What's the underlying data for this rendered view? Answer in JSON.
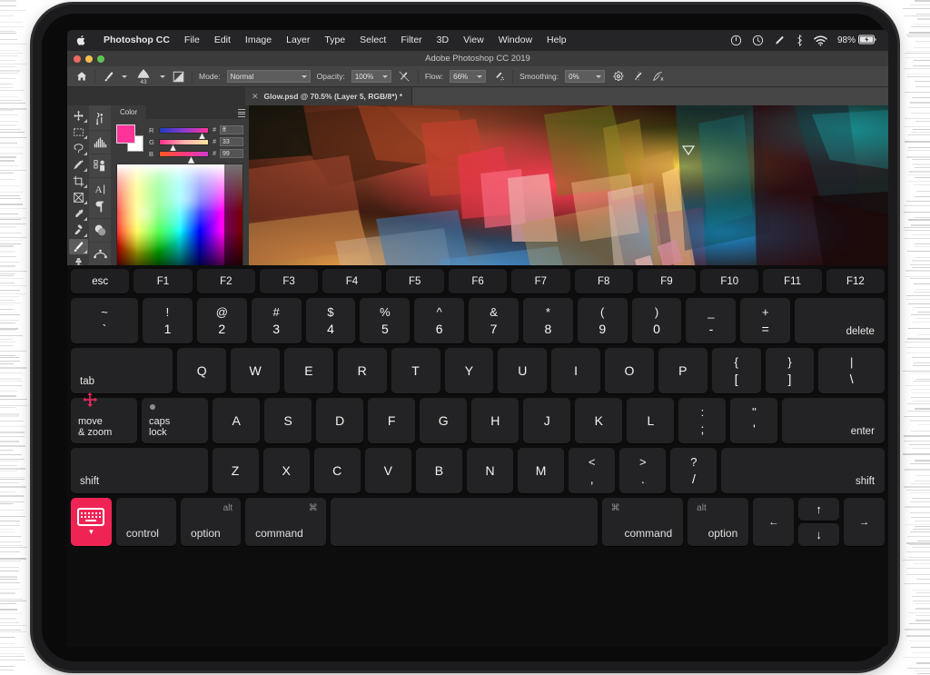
{
  "menubar": {
    "apple_icon": "apple-logo-icon",
    "app_name": "Photoshop CC",
    "items": [
      "File",
      "Edit",
      "Image",
      "Layer",
      "Type",
      "Select",
      "Filter",
      "3D",
      "View",
      "Window",
      "Help"
    ],
    "status": {
      "icons": [
        "power-circle-icon",
        "time-machine-icon",
        "pen-icon",
        "bluetooth-icon",
        "wifi-icon"
      ],
      "battery_percent": "98%",
      "battery_icon": "battery-charging-icon"
    }
  },
  "photoshop": {
    "window_title": "Adobe Photoshop CC 2019",
    "traffic_lights": [
      "close",
      "minimize",
      "zoom"
    ],
    "options_bar": {
      "home_icon": "home-icon",
      "brush_tool_icon": "brush-icon",
      "brush_size": "43",
      "brush_panel_icon": "brush-settings-icon",
      "mode_label": "Mode:",
      "mode_value": "Normal",
      "opacity_label": "Opacity:",
      "opacity_value": "100%",
      "opacity_pressure_icon": "pressure-opacity-icon",
      "flow_label": "Flow:",
      "flow_value": "66%",
      "airbrush_icon": "airbrush-icon",
      "smoothing_label": "Smoothing:",
      "smoothing_value": "0%",
      "smoothing_options_icon": "gear-icon",
      "symmetry_icon": "symmetry-icon",
      "pressure_size_icon": "pressure-size-icon"
    },
    "document_tab": {
      "close_icon": "close-icon",
      "title": "Glow.psd @ 70.5% (Layer 5, RGB/8*) *"
    },
    "toolbox": [
      {
        "name": "move-tool",
        "icon": "move-icon",
        "active": false
      },
      {
        "name": "marquee-tool",
        "icon": "rectangular-marquee-icon",
        "active": false
      },
      {
        "name": "lasso-tool",
        "icon": "lasso-icon",
        "active": false
      },
      {
        "name": "quick-selection-tool",
        "icon": "magic-wand-icon",
        "active": false
      },
      {
        "name": "crop-tool",
        "icon": "crop-icon",
        "active": false
      },
      {
        "name": "frame-tool",
        "icon": "frame-icon",
        "active": false
      },
      {
        "name": "eyedropper-tool",
        "icon": "eyedropper-icon",
        "active": false
      },
      {
        "name": "healing-brush-tool",
        "icon": "healing-brush-icon",
        "active": false
      },
      {
        "name": "brush-tool",
        "icon": "brush-icon",
        "active": true
      },
      {
        "name": "clone-stamp-tool",
        "icon": "clone-stamp-icon",
        "active": false
      },
      {
        "name": "history-brush-tool",
        "icon": "history-brush-icon",
        "active": false
      },
      {
        "name": "eraser-tool",
        "icon": "eraser-icon",
        "active": false
      },
      {
        "name": "gradient-tool",
        "icon": "paint-bucket-icon",
        "active": false
      }
    ],
    "panel_rail": [
      {
        "name": "panel-curves",
        "icon": "curves-icon"
      },
      {
        "name": "panel-histogram",
        "icon": "histogram-icon"
      },
      {
        "name": "panel-adjustments",
        "icon": "adjustments-icon"
      },
      {
        "name": "panel-character",
        "icon": "character-icon"
      },
      {
        "name": "panel-paragraph",
        "icon": "paragraph-icon"
      },
      {
        "name": "panel-layer-comps",
        "icon": "layer-comps-icon"
      },
      {
        "name": "panel-paths",
        "icon": "paths-icon"
      },
      {
        "name": "panel-properties",
        "icon": "properties-icon"
      }
    ],
    "color_panel": {
      "tab_label": "Color",
      "menu_icon": "panel-menu-icon",
      "foreground_color": "#ff3399",
      "background_color": "#ffffff",
      "channels": [
        {
          "label": "R",
          "hash": "#",
          "value": "ff",
          "pos": 100
        },
        {
          "label": "G",
          "hash": "#",
          "value": "33",
          "pos": 20
        },
        {
          "label": "B",
          "hash": "#",
          "value": "99",
          "pos": 60
        }
      ]
    }
  },
  "keyboard": {
    "rows": {
      "function": [
        "esc",
        "F1",
        "F2",
        "F3",
        "F4",
        "F5",
        "F6",
        "F7",
        "F8",
        "F9",
        "F10",
        "F11",
        "F12"
      ],
      "number": [
        {
          "top": "~",
          "bot": "`"
        },
        {
          "top": "!",
          "bot": "1"
        },
        {
          "top": "@",
          "bot": "2"
        },
        {
          "top": "#",
          "bot": "3"
        },
        {
          "top": "$",
          "bot": "4"
        },
        {
          "top": "%",
          "bot": "5"
        },
        {
          "top": "^",
          "bot": "6"
        },
        {
          "top": "&",
          "bot": "7"
        },
        {
          "top": "*",
          "bot": "8"
        },
        {
          "top": "(",
          "bot": "9"
        },
        {
          "top": ")",
          "bot": "0"
        },
        {
          "top": "_",
          "bot": "-"
        },
        {
          "top": "+",
          "bot": "="
        }
      ],
      "delete_label": "delete",
      "tab_label": "tab",
      "qwerty": [
        "Q",
        "W",
        "E",
        "R",
        "T",
        "Y",
        "U",
        "I",
        "O",
        "P"
      ],
      "qwerty_punct": [
        {
          "top": "{",
          "bot": "["
        },
        {
          "top": "}",
          "bot": "]"
        },
        {
          "top": "|",
          "bot": "\\"
        }
      ],
      "move_zoom": {
        "line1": "move",
        "line2": "& zoom",
        "icon": "move-and-zoom-icon"
      },
      "caps_lock": {
        "line1": "caps",
        "line2": "lock",
        "indicator": "caps-lock-indicator"
      },
      "home": [
        "A",
        "S",
        "D",
        "F",
        "G",
        "H",
        "J",
        "K",
        "L"
      ],
      "home_punct": [
        {
          "top": ":",
          "bot": ";"
        },
        {
          "top": "\"",
          "bot": "'"
        }
      ],
      "enter_label": "enter",
      "shift_left_label": "shift",
      "shift_right_label": "shift",
      "zxcv": [
        "Z",
        "X",
        "C",
        "V",
        "B",
        "N",
        "M"
      ],
      "zxcv_punct": [
        {
          "top": "<",
          "bot": ","
        },
        {
          "top": ">",
          "bot": "."
        },
        {
          "top": "?",
          "bot": "/"
        }
      ],
      "dismiss_key": {
        "icon": "hide-keyboard-icon",
        "chevron": "chevron-down-icon"
      },
      "control_label": "control",
      "option_left": {
        "label": "option",
        "sup": "alt"
      },
      "command_left": {
        "label": "command",
        "sup": "⌘"
      },
      "space_label": "",
      "command_right": {
        "label": "command",
        "sup": "⌘"
      },
      "option_right": {
        "label": "option",
        "sup": "alt"
      },
      "arrows": {
        "left": "←",
        "up": "↑",
        "down": "↓",
        "right": "→"
      }
    }
  }
}
